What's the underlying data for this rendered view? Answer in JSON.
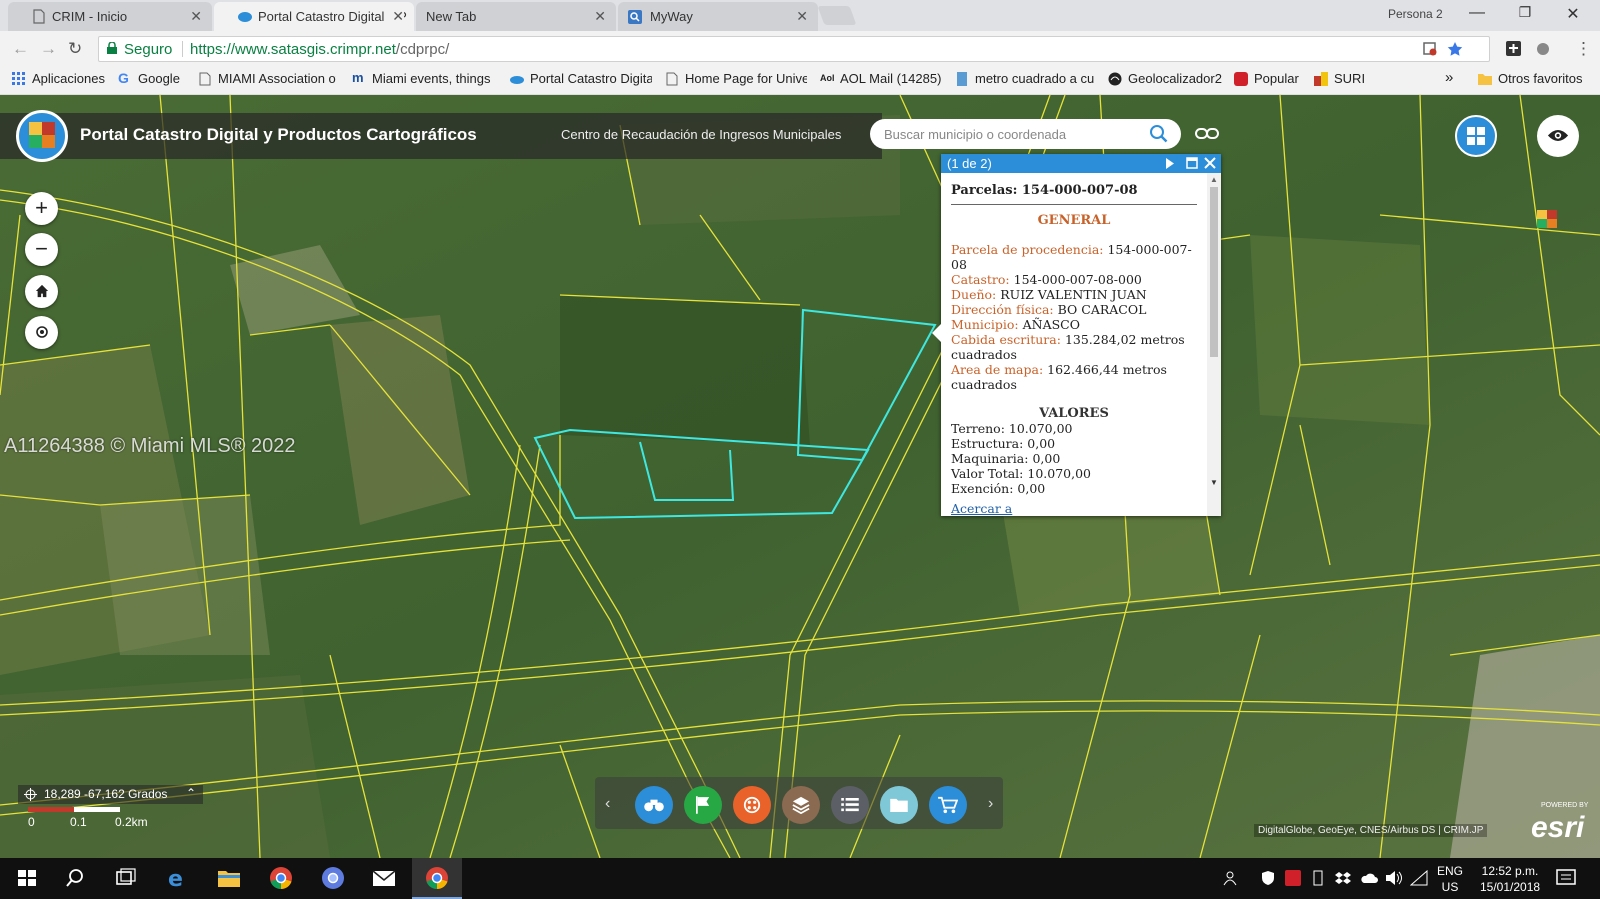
{
  "browser": {
    "tabs": [
      {
        "label": "CRIM - Inicio"
      },
      {
        "label": "Portal Catastro Digital y P"
      },
      {
        "label": "New Tab"
      },
      {
        "label": "MyWay"
      }
    ],
    "profile": "Persona 2",
    "secure_label": "Seguro",
    "url_host": "https://www.satasgis.crimpr.net",
    "url_path": "/cdprpc/",
    "bookmarks": [
      {
        "label": "Aplicaciones"
      },
      {
        "label": "Google"
      },
      {
        "label": "MIAMI Association of"
      },
      {
        "label": "Miami events, things"
      },
      {
        "label": "Portal Catastro Digita"
      },
      {
        "label": "Home Page for Unive"
      },
      {
        "label": "AOL Mail (14285)"
      },
      {
        "label": "metro cuadrado a cu"
      },
      {
        "label": "Geolocalizador2"
      },
      {
        "label": "Popular"
      },
      {
        "label": "SURI"
      }
    ],
    "more_bookmarks": "»",
    "other_bookmarks": "Otros favoritos"
  },
  "app": {
    "title": "Portal Catastro Digital y Productos Cartográficos",
    "subtitle": "Centro de Recaudación de Ingresos Municipales",
    "search_placeholder": "Buscar municipio o coordenada"
  },
  "watermark": "A11264388 © Miami MLS® 2022",
  "popup": {
    "counter": "(1 de 2)",
    "title": "Parcelas: 154-000-007-08",
    "section_general": "GENERAL",
    "fields": [
      {
        "label": "Parcela de procedencia:",
        "value": "154-000-007-08"
      },
      {
        "label": "Catastro:",
        "value": "154-000-007-08-000"
      },
      {
        "label": "Dueño:",
        "value": "RUIZ VALENTIN JUAN"
      },
      {
        "label": "Dirección física:",
        "value": "BO CARACOL"
      },
      {
        "label": "Municipio:",
        "value": "AÑASCO"
      },
      {
        "label": "Cabida escritura:",
        "value": "135.284,02 metros cuadrados"
      },
      {
        "label": "Area de mapa:",
        "value": "162.466,44 metros cuadrados"
      }
    ],
    "section_valores": "VALORES",
    "valores": [
      {
        "label": "Terreno:",
        "value": "10.070,00"
      },
      {
        "label": "Estructura:",
        "value": "0,00"
      },
      {
        "label": "Maquinaria:",
        "value": "0,00"
      },
      {
        "label": "Valor Total:",
        "value": "10.070,00"
      },
      {
        "label": "Exención:",
        "value": "0,00"
      }
    ],
    "zoom_link": "Acercar a"
  },
  "map": {
    "coords": "18,289 -67,162 Grados",
    "scale_labels": [
      "0",
      "0.1",
      "0.2km"
    ],
    "attribution": "DigitalGlobe, GeoEye, CNES/Airbus DS | CRIM.JP",
    "brand": "esri",
    "brand_caption": "POWERED BY"
  },
  "taskbar": {
    "lang_1": "ENG",
    "lang_2": "US",
    "time": "12:52 p.m.",
    "date": "15/01/2018"
  },
  "colors": {
    "accent": "#2c8ed8",
    "parcel_line": "#e6e23a",
    "selected_parcel": "#3ee8e0",
    "field_label": "#c8622a"
  }
}
